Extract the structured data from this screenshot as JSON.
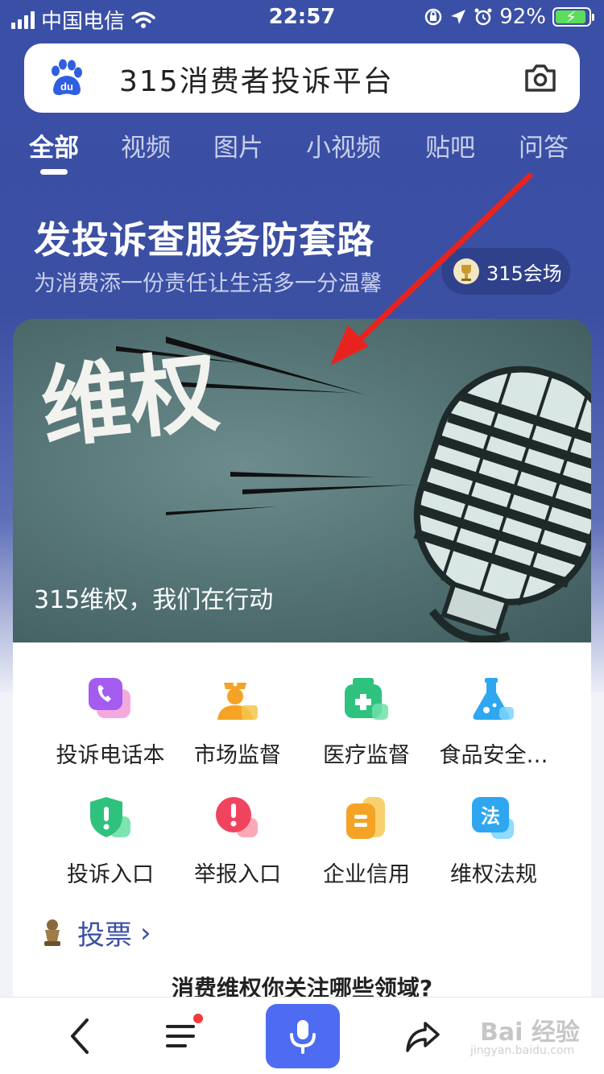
{
  "status_bar": {
    "carrier": "中国电信",
    "time": "22:57",
    "battery": "92%"
  },
  "search": {
    "query": "315消费者投诉平台"
  },
  "tabs": [
    {
      "label": "全部",
      "active": true
    },
    {
      "label": "视频",
      "active": false
    },
    {
      "label": "图片",
      "active": false
    },
    {
      "label": "小视频",
      "active": false
    },
    {
      "label": "贴吧",
      "active": false
    },
    {
      "label": "问答",
      "active": false
    }
  ],
  "hero": {
    "title": "发投诉查服务防套路",
    "subtitle": "为消费添一份责任让生活多一分温馨",
    "venue_chip": "315会场"
  },
  "banner": {
    "headline": "维权",
    "caption": "315维权，我们在行动"
  },
  "services": [
    {
      "label": "投诉电话本",
      "icon": "phone-chat-icon",
      "color": "#a45cf0"
    },
    {
      "label": "市场监督",
      "icon": "officer-icon",
      "color": "#f4a326"
    },
    {
      "label": "医疗监督",
      "icon": "medical-kit-icon",
      "color": "#2ec27e"
    },
    {
      "label": "食品安全…",
      "icon": "flask-icon",
      "color": "#2ea7f0"
    },
    {
      "label": "投诉入口",
      "icon": "shield-alert-icon",
      "color": "#2ec27e"
    },
    {
      "label": "举报入口",
      "icon": "alert-circle-icon",
      "color": "#f0445e"
    },
    {
      "label": "企业信用",
      "icon": "credit-icon",
      "color": "#f4a326"
    },
    {
      "label": "维权法规",
      "icon": "law-icon",
      "color": "#2ea7f0"
    }
  ],
  "vote": {
    "label": "投票",
    "question": "消费维权你关注哪些领域?"
  },
  "bottom_bar": {
    "watermark": "Bai 经验",
    "watermark_sub": "jingyan.baidu.com"
  },
  "colors": {
    "brand_blue": "#3a4fa6",
    "voice_button": "#4e6cf2",
    "arrow_red": "#e8231f"
  }
}
